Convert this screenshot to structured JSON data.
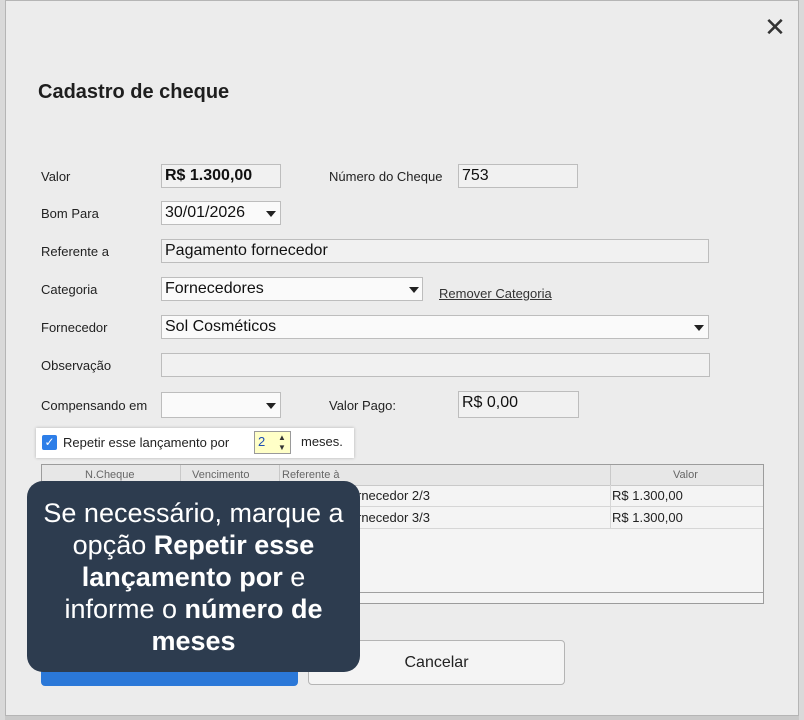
{
  "dialog": {
    "title": "Cadastro de cheque",
    "close_glyph": "✕"
  },
  "form": {
    "valor_label": "Valor",
    "valor_value": "R$ 1.300,00",
    "numero_label": "Número do Cheque",
    "numero_value": "753",
    "bom_para_label": "Bom Para",
    "bom_para_value": "30/01/2026",
    "referente_label": "Referente a",
    "referente_value": "Pagamento fornecedor",
    "categoria_label": "Categoria",
    "categoria_value": "Fornecedores",
    "remover_categoria": "Remover Categoria",
    "fornecedor_label": "Fornecedor",
    "fornecedor_value": "Sol Cosméticos",
    "observacao_label": "Observação",
    "observacao_value": "",
    "compensando_label": "Compensando em",
    "compensando_value": "",
    "valor_pago_label": "Valor Pago:",
    "valor_pago_value": "R$ 0,00"
  },
  "repeat": {
    "checked": true,
    "check_glyph": "✓",
    "label": "Repetir esse lançamento por",
    "months": "2",
    "suffix": "meses."
  },
  "table": {
    "columns": [
      "N.Cheque",
      "Vencimento",
      "Referente à",
      "Valor"
    ],
    "rows": [
      {
        "referente": "rnecedor 2/3",
        "valor": "R$ 1.300,00"
      },
      {
        "referente": "rnecedor 3/3",
        "valor": "R$ 1.300,00"
      }
    ]
  },
  "buttons": {
    "cancel_label": "Cancelar"
  },
  "tooltip": {
    "text_1": "Se necessário, marque a opção ",
    "bold_1": "Repetir esse lançamento por",
    "text_2": " e informe o ",
    "bold_2": "número de meses"
  },
  "colors": {
    "accent": "#2b78d8",
    "tooltip_bg": "#2d3c4f",
    "spinner_bg": "#ffffc7"
  }
}
